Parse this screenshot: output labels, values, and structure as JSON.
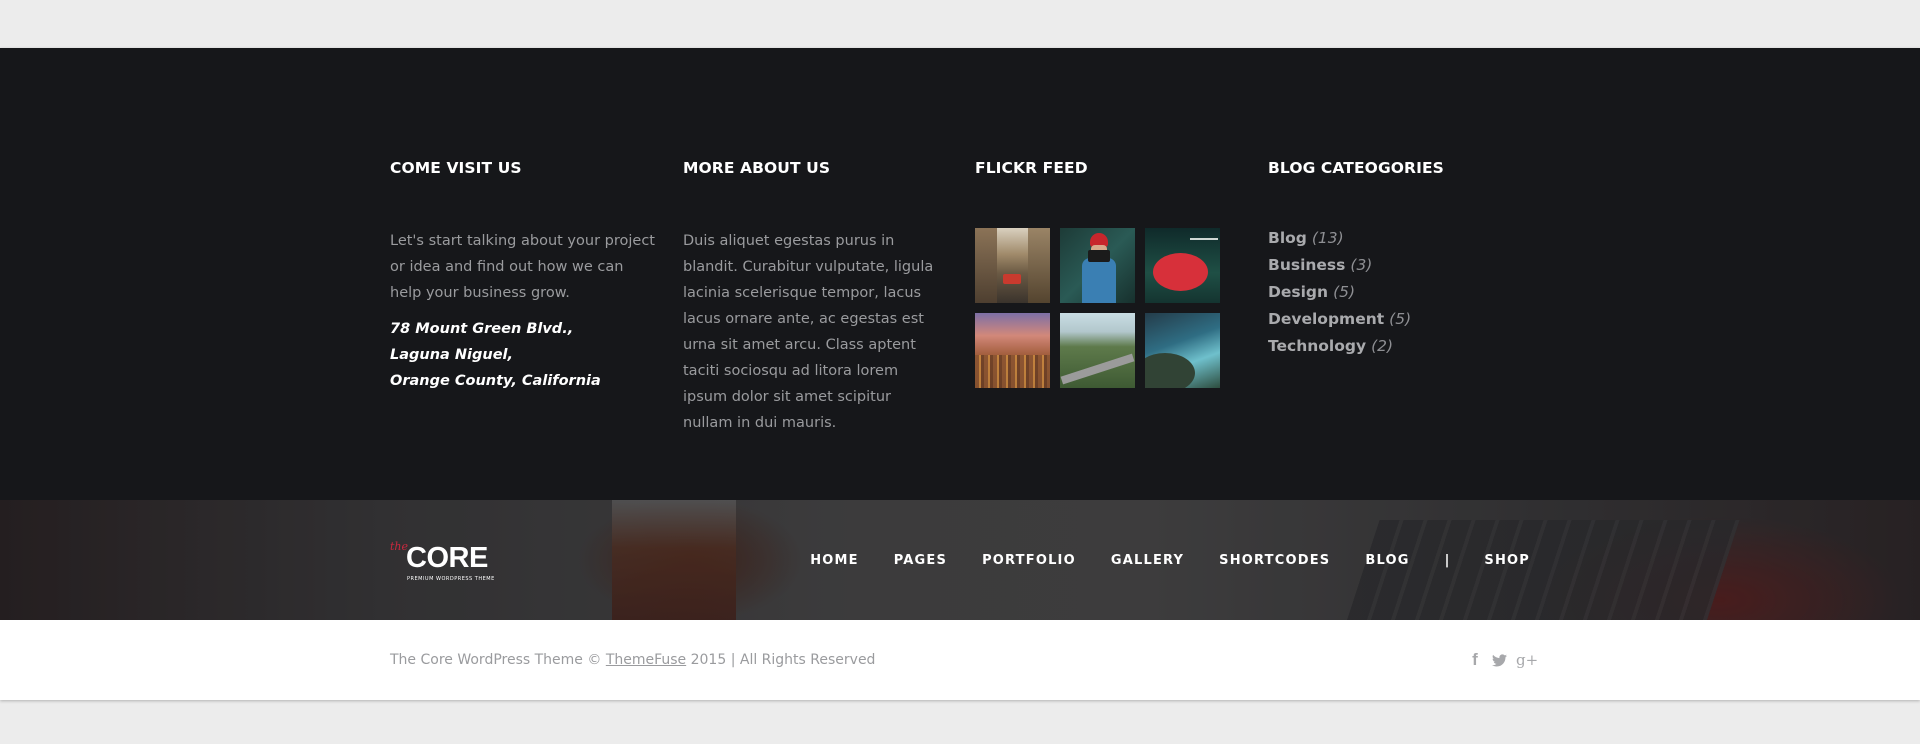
{
  "visit": {
    "heading": "COME VISIT US",
    "text": "Let's start talking about your project or idea and find out how we can help your business grow.",
    "address": [
      "78 Mount Green Blvd.,",
      "Laguna Niguel,",
      "Orange County, California"
    ]
  },
  "about": {
    "heading": "MORE ABOUT US",
    "text": "Duis aliquet egestas purus in blandit. Curabitur vulputate, ligula lacinia scelerisque tempor, lacus lacus ornare ante, ac egestas est urna sit amet arcu. Class aptent taciti sociosqu ad litora lorem ipsum dolor sit amet scipitur nullam in dui mauris."
  },
  "flickr": {
    "heading": "FLICKR FEED",
    "photos": [
      "street-photo",
      "photographer-photo",
      "red-umbrella-photo",
      "city-sunset-photo",
      "mountain-road-photo",
      "coastline-photo"
    ]
  },
  "categories": {
    "heading": "BLOG CATEOGORIES",
    "items": [
      {
        "label": "Blog",
        "count": "(13)"
      },
      {
        "label": "Business",
        "count": "(3)"
      },
      {
        "label": "Design",
        "count": "(5)"
      },
      {
        "label": "Development",
        "count": "(5)"
      },
      {
        "label": "Technology",
        "count": "(2)"
      }
    ]
  },
  "logo": {
    "the": "the",
    "core": "CORE",
    "tagline": "PREMIUM WORDPRESS THEME"
  },
  "nav": {
    "items": [
      "HOME",
      "PAGES",
      "PORTFOLIO",
      "GALLERY",
      "SHORTCODES",
      "BLOG"
    ],
    "separator": "|",
    "shop": "SHOP"
  },
  "footer": {
    "prefix": "The Core WordPress Theme © ",
    "link": "ThemeFuse",
    "suffix": " 2015 | All Rights Reserved",
    "social": [
      "facebook-icon",
      "twitter-icon",
      "google-plus-icon"
    ]
  },
  "colors": {
    "widgets_bg": "#16171a",
    "accent": "#c9283e",
    "muted_text": "#9a9b9e"
  }
}
